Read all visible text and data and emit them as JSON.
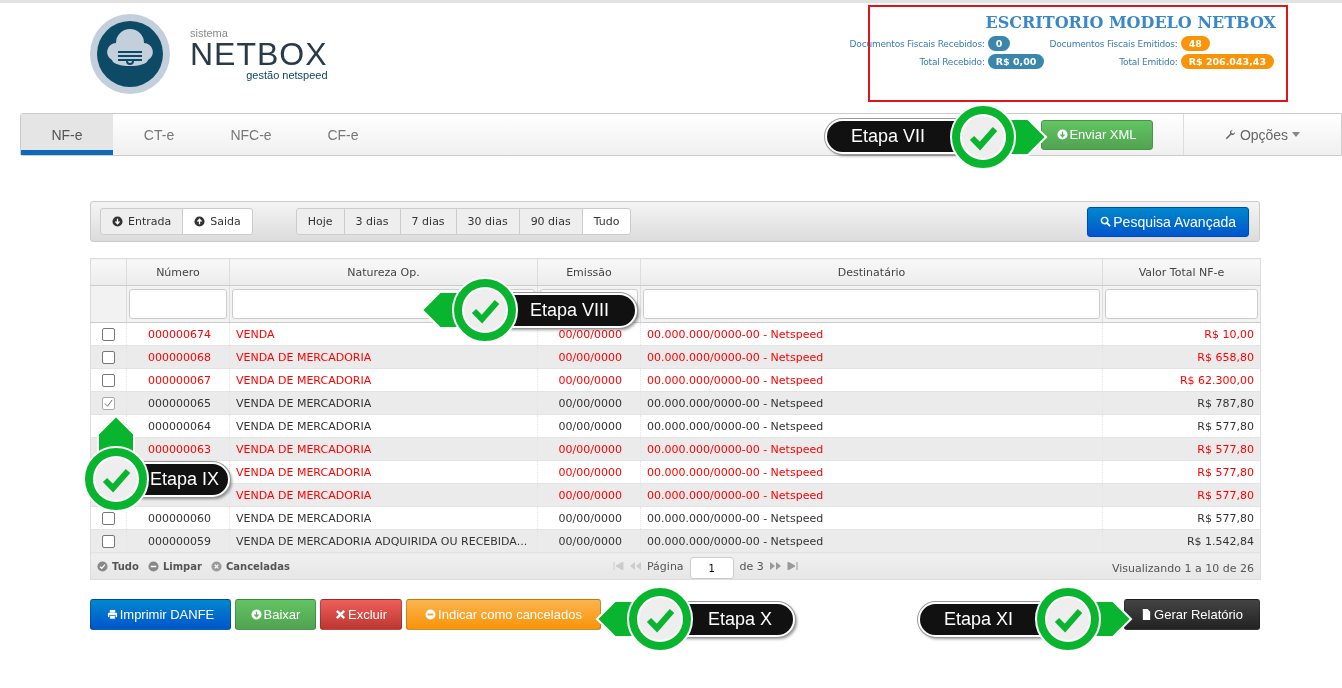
{
  "header": {
    "logo": {
      "small": "sistema",
      "name": "NETBOX",
      "tagline": "gestão netspeed"
    },
    "summary": {
      "title": "ESCRITORIO MODELO NETBOX",
      "stats": [
        {
          "label": "Documentos Fiscais Recebidos:",
          "value": "0",
          "color": "#3a87ad"
        },
        {
          "label": "Documentos Fiscais Emitidos:",
          "value": "48",
          "color": "#f89406"
        },
        {
          "label": "Total Recebido:",
          "value": "R$ 0,00",
          "color": "#3a87ad"
        },
        {
          "label": "Total Emitido:",
          "value": "R$ 206.043,43",
          "color": "#f89406"
        }
      ]
    }
  },
  "nav": {
    "tabs": [
      {
        "label": "NF-e",
        "selected": true
      },
      {
        "label": "CT-e",
        "selected": false
      },
      {
        "label": "NFC-e",
        "selected": false
      },
      {
        "label": "CF-e",
        "selected": false
      }
    ],
    "send_button": "Enviar XML",
    "options": "Opções"
  },
  "filters": {
    "direction": [
      {
        "label": "Entrada",
        "selected": false,
        "kind": "in"
      },
      {
        "label": "Saida",
        "selected": true,
        "kind": "out"
      }
    ],
    "periods": [
      {
        "label": "Hoje",
        "selected": false
      },
      {
        "label": "3 dias",
        "selected": false
      },
      {
        "label": "7 dias",
        "selected": false
      },
      {
        "label": "30 dias",
        "selected": false
      },
      {
        "label": "90 dias",
        "selected": false
      },
      {
        "label": "Tudo",
        "selected": true
      }
    ],
    "search_button": "Pesquisa Avançada"
  },
  "table": {
    "columns": [
      "Número",
      "Natureza Op.",
      "Emissão",
      "Destinatário",
      "Valor Total NF-e"
    ],
    "rows": [
      {
        "checked": false,
        "canceled": true,
        "number": "000000674",
        "nature": "VENDA",
        "date": "00/00/0000",
        "recipient": "00.000.000/0000-00 - Netspeed",
        "value": "R$ 10,00"
      },
      {
        "checked": false,
        "canceled": true,
        "number": "000000068",
        "nature": "VENDA DE MERCADORIA",
        "date": "00/00/0000",
        "recipient": "00.000.000/0000-00 - Netspeed",
        "value": "R$ 658,80"
      },
      {
        "checked": false,
        "canceled": true,
        "number": "000000067",
        "nature": "VENDA DE MERCADORIA",
        "date": "00/00/0000",
        "recipient": "00.000.000/0000-00 - Netspeed",
        "value": "R$ 62.300,00"
      },
      {
        "checked": true,
        "canceled": false,
        "number": "000000065",
        "nature": "VENDA DE MERCADORIA",
        "date": "00/00/0000",
        "recipient": "00.000.000/0000-00 - Netspeed",
        "value": "R$ 787,80"
      },
      {
        "canceled": false,
        "number": "000000064",
        "nature": "VENDA DE MERCADORIA",
        "date": "00/00/0000",
        "recipient": "00.000.000/0000-00 - Netspeed",
        "value": "R$ 577,80"
      },
      {
        "canceled": true,
        "number": "000000063",
        "nature": "VENDA DE MERCADORIA",
        "date": "00/00/0000",
        "recipient": "00.000.000/0000-00 - Netspeed",
        "value": "R$ 577,80"
      },
      {
        "canceled": true,
        "nature": "VENDA DE MERCADORIA",
        "date": "00/00/0000",
        "recipient": "00.000.000/0000-00 - Netspeed",
        "value": "R$ 577,80"
      },
      {
        "canceled": true,
        "nature": "VENDA DE MERCADORIA",
        "date": "00/00/0000",
        "recipient": "00.000.000/0000-00 - Netspeed",
        "value": "R$ 577,80"
      },
      {
        "checked": false,
        "canceled": false,
        "number": "000000060",
        "nature": "VENDA DE MERCADORIA",
        "date": "00/00/0000",
        "recipient": "00.000.000/0000-00 - Netspeed",
        "value": "R$ 577,80"
      },
      {
        "checked": false,
        "canceled": false,
        "number": "000000059",
        "nature": "VENDA DE MERCADORIA ADQUIRIDA OU RECEBIDA...",
        "date": "00/00/0000",
        "recipient": "00.000.000/0000-00 - Netspeed",
        "value": "R$ 1.542,84"
      }
    ]
  },
  "footer": {
    "selectors": [
      {
        "label": "Tudo",
        "kind": "all"
      },
      {
        "label": "Limpar",
        "kind": "clear"
      },
      {
        "label": "Canceladas",
        "kind": "canceled"
      }
    ],
    "page_label": "Página",
    "page": "1",
    "page_total": "de 3",
    "summary": "Visualizando 1 a 10 de 26"
  },
  "actions": [
    {
      "label": "Imprimir DANFE",
      "kind": "print"
    },
    {
      "label": "Baixar",
      "kind": "download"
    },
    {
      "label": "Excluir",
      "kind": "delete"
    },
    {
      "label": "Indicar como cancelados",
      "kind": "cancel"
    }
  ],
  "report_button": "Gerar Relatório",
  "callouts": [
    {
      "label": "Etapa VII",
      "kind": "right"
    },
    {
      "label": "Etapa VIII",
      "kind": "left"
    },
    {
      "label": "Etapa IX",
      "kind": "up"
    },
    {
      "label": "Etapa X",
      "kind": "left"
    },
    {
      "label": "Etapa XI",
      "kind": "right"
    }
  ]
}
